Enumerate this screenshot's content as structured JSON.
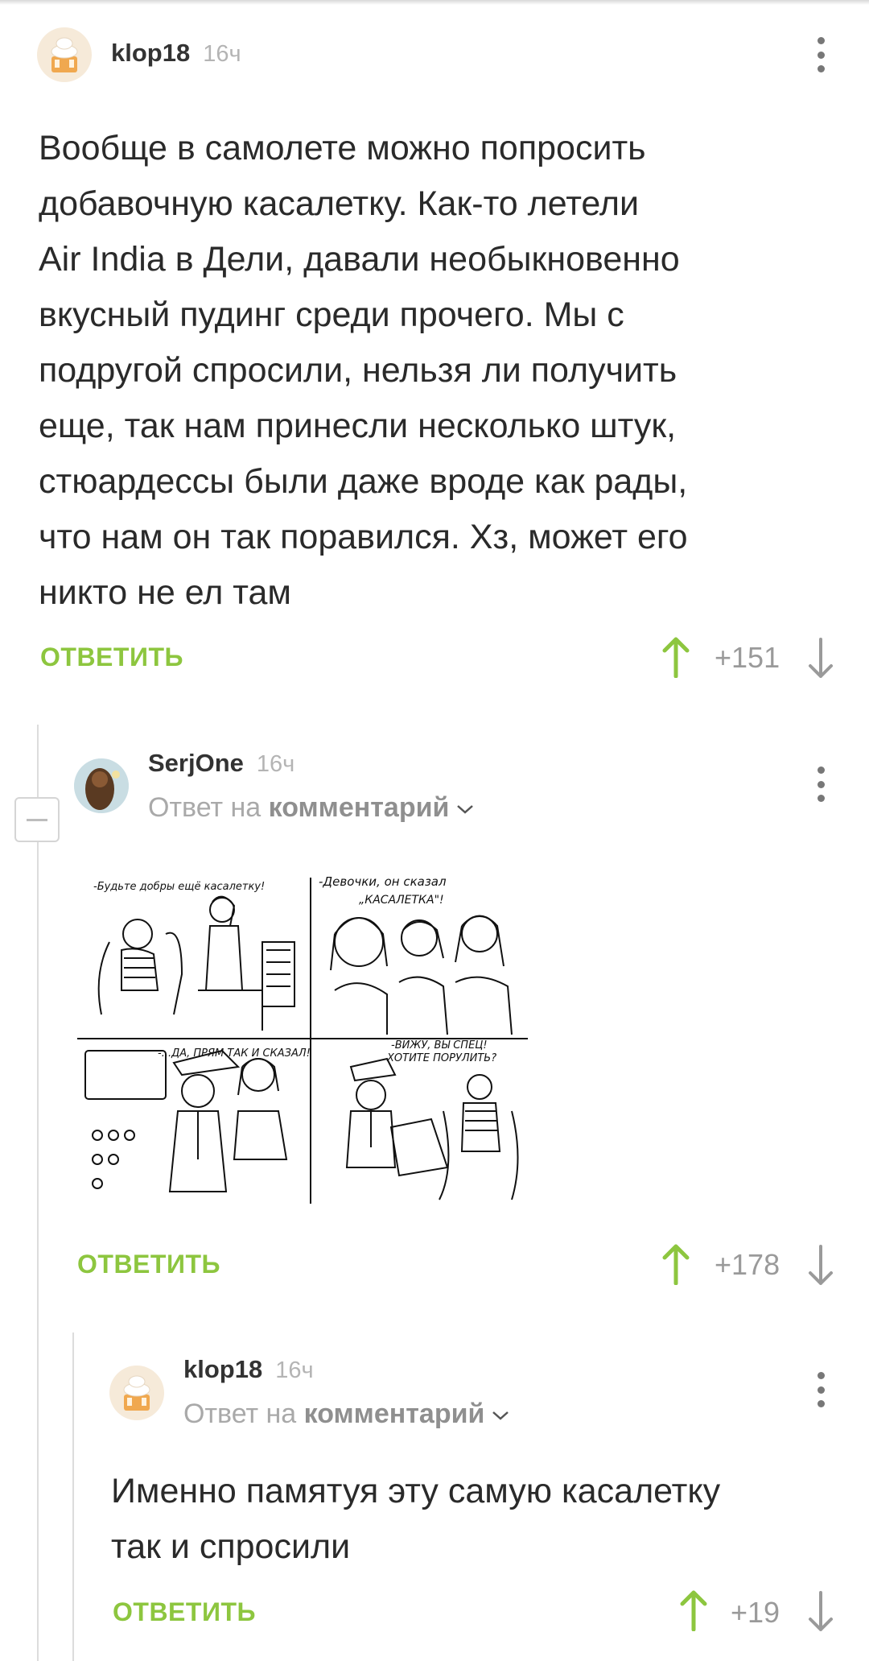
{
  "comments": [
    {
      "username": "klop18",
      "time": "16ч",
      "text_lines": [
        "Вообще в самолете можно попросить",
        "добавочную касалетку. Как-то летели",
        "Air India в Дели, давали необыкновенно",
        "вкусный пудинг среди прочего. Мы с",
        "подругой спросили, нельзя ли получить",
        "еще, так нам принесли несколько штук,",
        "стюардессы были даже вроде как рады,",
        "что нам он так поравился. Хз, может его",
        "никто не ел там"
      ],
      "reply_label": "ОТВЕТИТЬ",
      "score": "+151"
    },
    {
      "username": "SerjOne",
      "time": "16ч",
      "reply_to_prefix": "Ответ на",
      "reply_to_link": "комментарий",
      "comic_text": {
        "panel1": "-Будьте добры ещё касалетку!",
        "panel2_a": "-Девочки, он сказал",
        "panel2_b": "„КАСАЛЕТКА\"!",
        "panel3": "-...ДА, ПРЯМ ТАК И СКАЗАЛ!",
        "panel4_a": "-ВИЖУ, ВЫ СПЕЦ!",
        "panel4_b": "ХОТИТЕ ПОРУЛИТЬ?"
      },
      "reply_label": "ОТВЕТИТЬ",
      "score": "+178"
    },
    {
      "username": "klop18",
      "time": "16ч",
      "reply_to_prefix": "Ответ на",
      "reply_to_link": "комментарий",
      "text_lines": [
        "Именно памятуя эту самую касалетку",
        "так и спросили"
      ],
      "reply_label": "ОТВЕТИТЬ",
      "score": "+19"
    }
  ],
  "colors": {
    "accent_green": "#8dc63f",
    "muted_gray": "#9a9a9a"
  }
}
